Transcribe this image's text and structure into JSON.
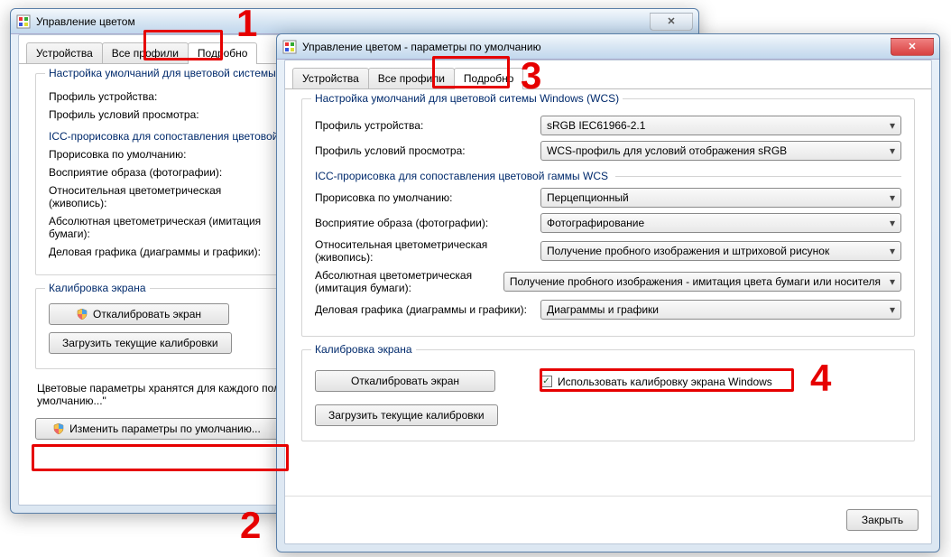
{
  "back": {
    "title": "Управление цветом",
    "tabs": [
      "Устройства",
      "Все профили",
      "Подробно"
    ],
    "wcs_legend": "Настройка умолчаний для цветовой системы",
    "labels": {
      "device_profile": "Профиль устройства:",
      "viewing_profile": "Профиль условий просмотра:",
      "icc_title": "ICC-прорисовка для сопоставления цветовой",
      "render_default": "Прорисовка по умолчанию:",
      "perceptual": "Восприятие образа (фотографии):",
      "rel_color": "Относительная цветометрическая (живопись):",
      "abs_color": "Абсолютная цветометрическая (имитация бумаги):",
      "business": "Деловая графика (диаграммы и графики):",
      "calib": "Калибровка экрана",
      "calibrate_btn": "Откалибровать экран",
      "load_btn": "Загрузить текущие калибровки"
    },
    "note": "Цветовые параметры хранятся для каждого пользователя. Для общих принтеров, нажмите кнопку \"Изменить параметры по умолчанию...\"",
    "change_defaults": "Изменить параметры по умолчанию..."
  },
  "front": {
    "title": "Управление цветом - параметры по умолчанию",
    "tabs": [
      "Устройства",
      "Все профили",
      "Подробно"
    ],
    "wcs_legend": "Настройка умолчаний для цветовой ситемы Windows (WCS)",
    "labels": {
      "device_profile": "Профиль устройства:",
      "viewing_profile": "Профиль условий просмотра:",
      "icc_title": "ICC-прорисовка для сопоставления цветовой гаммы WCS",
      "render_default": "Прорисовка по умолчанию:",
      "perceptual": "Восприятие образа (фотографии):",
      "rel_color": "Относительная цветометрическая (живопись):",
      "abs_color": "Абсолютная цветометрическая (имитация бумаги):",
      "business": "Деловая графика (диаграммы и графики):",
      "calib": "Калибровка экрана",
      "calibrate_btn": "Откалибровать экран",
      "load_btn": "Загрузить текущие калибровки",
      "use_win_calib": "Использовать калибровку экрана Windows"
    },
    "values": {
      "device_profile": "sRGB IEC61966-2.1",
      "viewing_profile": "WCS-профиль для условий отображения sRGB",
      "render_default": "Перцепционный",
      "perceptual": "Фотографирование",
      "rel_color": "Получение пробного изображения и штриховой рисунок",
      "abs_color": "Получение пробного изображения - имитация цвета бумаги или носителя",
      "business": "Диаграммы и графики"
    },
    "close_btn": "Закрыть"
  },
  "callouts": {
    "1": "1",
    "2": "2",
    "3": "3",
    "4": "4"
  }
}
